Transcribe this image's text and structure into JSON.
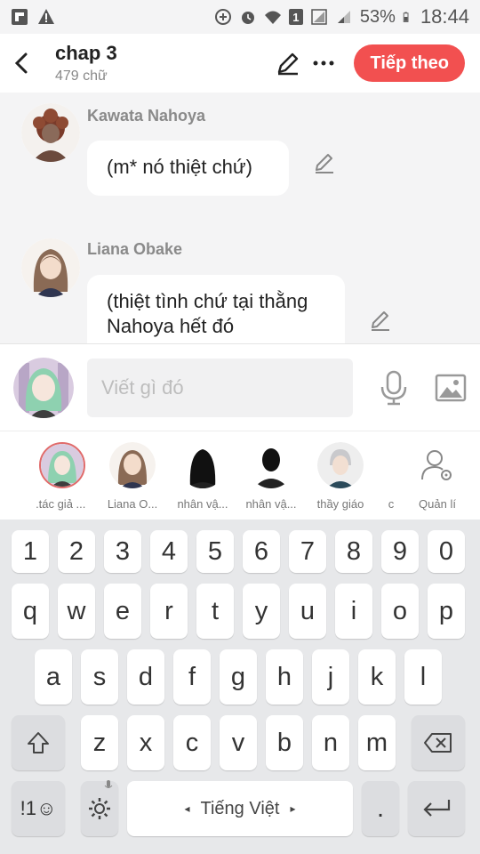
{
  "status_bar": {
    "notifications_count": "1",
    "battery_percent": "53%",
    "time": "18:44"
  },
  "header": {
    "title": "chap 3",
    "word_count": "479 chữ",
    "next_button": "Tiếp theo"
  },
  "messages": [
    {
      "sender": "Kawata Nahoya",
      "text": "(m* nó thiệt chứ)"
    },
    {
      "sender": "Liana Obake",
      "text": "(thiệt tình chứ tại thằng Nahoya hết đó"
    }
  ],
  "composer": {
    "placeholder": "Viết gì đó"
  },
  "characters": [
    {
      "label": "..."
    },
    {
      "label": "tác giả ..."
    },
    {
      "label": "Liana O..."
    },
    {
      "label": "nhân vậ..."
    },
    {
      "label": "nhân vậ..."
    },
    {
      "label": "thầy giáo"
    },
    {
      "label": "c"
    },
    {
      "label": "Quản lí"
    }
  ],
  "keyboard": {
    "row_numbers": [
      "1",
      "2",
      "3",
      "4",
      "5",
      "6",
      "7",
      "8",
      "9",
      "0"
    ],
    "row1": [
      "q",
      "w",
      "e",
      "r",
      "t",
      "y",
      "u",
      "i",
      "o",
      "p"
    ],
    "row2": [
      "a",
      "s",
      "d",
      "f",
      "g",
      "h",
      "j",
      "k",
      "l"
    ],
    "row3": [
      "z",
      "x",
      "c",
      "v",
      "b",
      "n",
      "m"
    ],
    "symbols_key": "!1☺",
    "space_label": "Tiếng Việt",
    "period_key": "."
  },
  "colors": {
    "accent": "#f25050",
    "background": "#f4f4f5"
  }
}
